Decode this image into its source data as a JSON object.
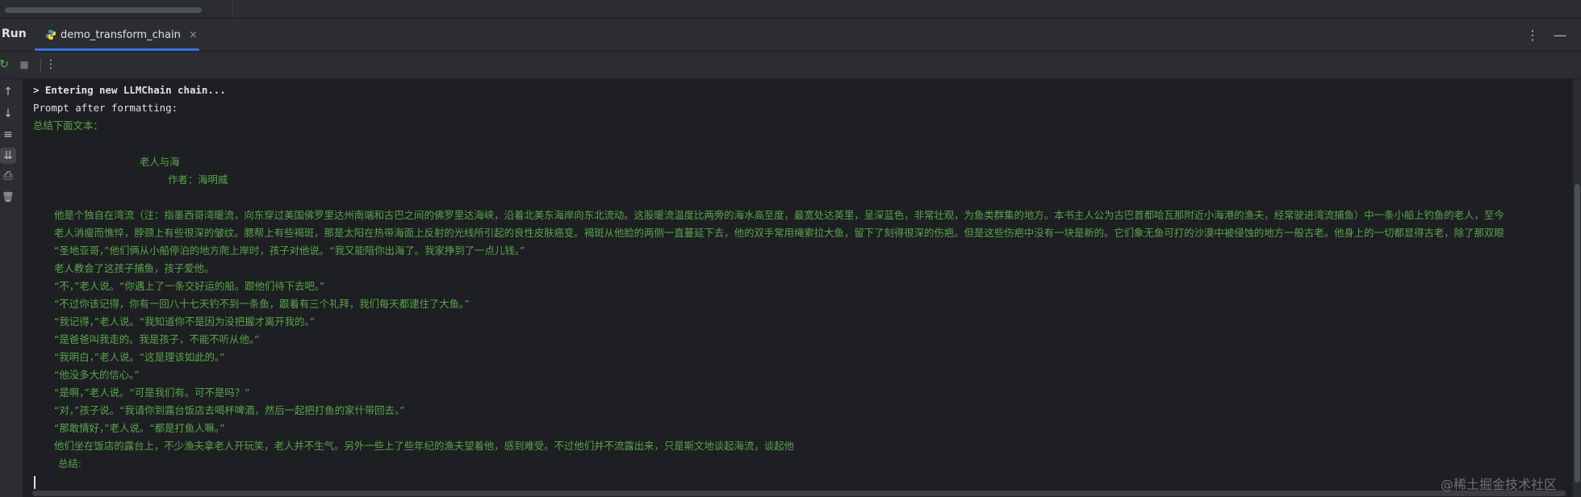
{
  "header": {
    "run_label": "Run",
    "tab_label": "demo_transform_chain",
    "tab_close": "×",
    "kebab_glyph": "⋮",
    "minimize_glyph": "—"
  },
  "toolbar": {
    "rerun_glyph": "↻",
    "stop_glyph": "■",
    "more_glyph": "⋮"
  },
  "gutter": {
    "up_glyph": "↑",
    "down_glyph": "↓",
    "wrap_glyph": "≡",
    "scroll_end_glyph": "⇊",
    "print_glyph": "⎙",
    "trash_glyph": "🗑"
  },
  "console": {
    "entering": "> Entering new LLMChain chain...",
    "prompt_after": "Prompt after formatting:",
    "summarize_heading": "总结下面文本：",
    "title": "老人与海",
    "author": "作者：海明威",
    "paragraphs": [
      "他是个独自在湾流（注：指墨西哥湾暖流，向东穿过美国佛罗里达州南端和古巴之间的佛罗里达海峡，沿着北美东海岸向东北流动。这股暖流温度比两旁的海水高至度，最宽处达英里，呈深蓝色，非常壮观，为鱼类群集的地方。本书主人公为古巴首都哈瓦那附近小海港的渔夫，经常驶进湾流捕鱼）中一条小船上钓鱼的老人，至今",
      "老人消瘦而憔悴，脖颈上有些很深的皱纹。腮帮上有些褐斑，那是太阳在热带海面上反射的光线所引起的良性皮肤癌变。褐斑从他脸的两侧一直蔓延下去，他的双手常用绳索拉大鱼，留下了刻得很深的伤疤。但是这些伤疤中没有一块是新的。它们象无鱼可打的沙漠中被侵蚀的地方一般古老。他身上的一切都显得古老，除了那双眼",
      "“圣地亚哥，”他们俩从小船停泊的地方爬上岸时，孩子对他说。“我又能陪你出海了。我家挣到了一点儿钱。”",
      "老人教会了这孩子捕鱼，孩子爱他。",
      "“不，”老人说。“你遇上了一条交好运的船。跟他们待下去吧。”",
      "“不过你该记得，你有一回八十七天钓不到一条鱼，跟着有三个礼拜，我们每天都逮住了大鱼。”",
      "“我记得，”老人说。“我知道你不是因为没把握才离开我的。”",
      "“是爸爸叫我走的。我是孩子，不能不听从他。”",
      "“我明白，”老人说。“这是理该如此的。”",
      "“他没多大的信心。”",
      "“是啊，”老人说。“可是我们有。可不是吗？”",
      "“对，”孩子说。“我请你到露台饭店去喝杯啤酒，然后一起把打鱼的家什带回去。”",
      "“那敢情好，”老人说。“都是打鱼人嘛。”",
      "他们坐在饭店的露台上，不少渔夫拿老人开玩笑，老人并不生气。另外一些上了些年纪的渔夫望着他，感到难受。不过他们并不流露出来，只是斯文地谈起海流，谈起他"
    ],
    "summary_label": "总结:"
  },
  "watermark": "@稀土掘金技术社区",
  "colors": {
    "console_text": "#dfe1e5",
    "prompt_green": "#57a64a",
    "accent": "#3574f0"
  }
}
